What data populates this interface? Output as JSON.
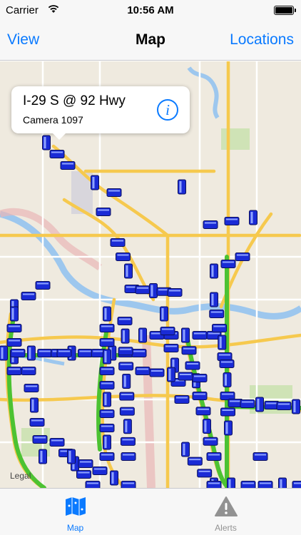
{
  "status_bar": {
    "carrier": "Carrier",
    "time": "10:56 AM"
  },
  "nav": {
    "left_button": "View",
    "title": "Map",
    "right_button": "Locations"
  },
  "callout": {
    "title": "I-29 S @ 92 Hwy",
    "subtitle": "Camera 1097",
    "info_icon": "i"
  },
  "map": {
    "legal": "Legal",
    "camera_icon": "camera-marker-icon"
  },
  "tabs": [
    {
      "label": "Map",
      "icon": "map-icon",
      "selected": true
    },
    {
      "label": "Alerts",
      "icon": "warning-icon",
      "selected": false
    }
  ],
  "colors": {
    "accent": "#0a7aff",
    "camera": "#1a2bd6",
    "traffic_green": "#4cc232",
    "highway": "#f6c94e"
  }
}
